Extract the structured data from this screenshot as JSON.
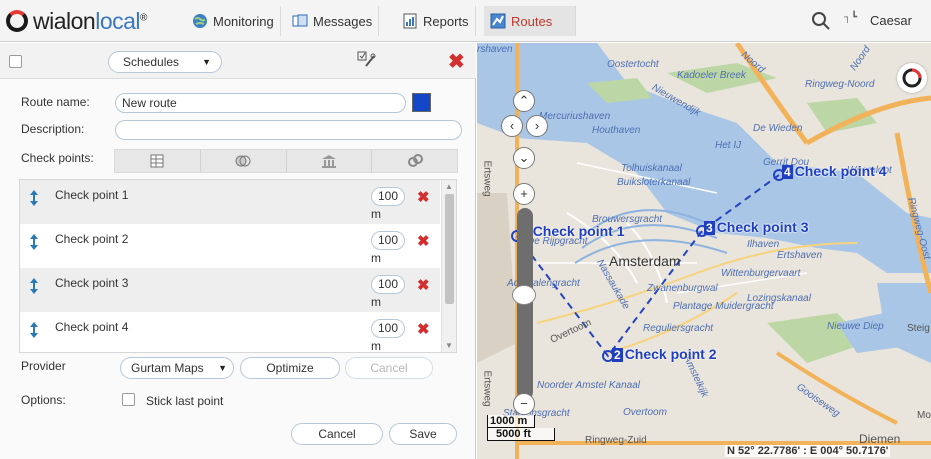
{
  "app": {
    "logo_text": "wialon",
    "logo_text_accent": "local",
    "logo_sup": "®"
  },
  "nav": {
    "tabs": [
      {
        "label": "Monitoring",
        "icon": "globe-icon"
      },
      {
        "label": "Messages",
        "icon": "messages-icon"
      },
      {
        "label": "Reports",
        "icon": "reports-icon"
      },
      {
        "label": "Routes",
        "icon": "routes-icon",
        "active": true
      }
    ],
    "search_icon": "search-icon",
    "small_icon": "window-icon",
    "user": "Caesar"
  },
  "panel": {
    "header": {
      "select_value": "Schedules",
      "tools_icon": "edit-tools-icon",
      "close_icon": "close-icon"
    },
    "route_name_label": "Route name:",
    "route_name_value": "New route",
    "route_color": "#1446c8",
    "description_label": "Description:",
    "description_value": "",
    "checkpoints_label": "Check points:",
    "toolbar_icons": [
      "table-icon",
      "geozones-icon",
      "buildings-icon",
      "address-icon"
    ],
    "checkpoints": [
      {
        "name": "Check point 1",
        "radius": "100",
        "unit": "m"
      },
      {
        "name": "Check point 2",
        "radius": "100",
        "unit": "m"
      },
      {
        "name": "Check point 3",
        "radius": "100",
        "unit": "m"
      },
      {
        "name": "Check point 4",
        "radius": "100",
        "unit": "m"
      }
    ],
    "provider_label": "Provider",
    "provider_value": "Gurtam Maps",
    "optimize_label": "Optimize",
    "cancel_provider_label": "Cancel",
    "options_label": "Options:",
    "stick_last_label": "Stick last point",
    "cancel_label": "Cancel",
    "save_label": "Save"
  },
  "map": {
    "labels": [
      "rshaven",
      "Oostertocht",
      "Kadoeler Breek",
      "Noord",
      "Ringweg-Noord",
      "Noord",
      "Mercuriushaven",
      "Nieuwendijk",
      "Houthaven",
      "De Wieden",
      "Het IJ",
      "Tolhuiskanaal",
      "Buiksloterkanaal",
      "Gerrit Dou",
      "Weersloot",
      "Brouwersgracht",
      "De Rijpgracht",
      "Ilhaven",
      "Ertshaven",
      "Amsterdam",
      "Admiralengracht",
      "Nassaukade",
      "Wittenburgervaart",
      "Zwanenburgwal",
      "Lozingskanaal",
      "Plantage Muidergracht",
      "Overtoom",
      "Reguliersgracht",
      "Nieuwe Diep",
      "Steig",
      "Noorder Amstel Kanaal",
      "Amstelkijk",
      "Stadionsgracht",
      "Overtoom",
      "Ringweg-Zuid",
      "Diemen",
      "Mo",
      "Gooiseweg",
      "Ringweg-Oost",
      "Ertsweg",
      "Ertsweg"
    ],
    "checkpoint_labels": [
      {
        "num": "1",
        "text": "Check point 1"
      },
      {
        "num": "2",
        "text": "Check point 2"
      },
      {
        "num": "3",
        "text": "Check point 3"
      },
      {
        "num": "4",
        "text": "Check point 4"
      }
    ],
    "scale_metric": "1000 m",
    "scale_imperial": "5000 ft",
    "coords": "N 52° 22.7786' : E 004° 50.7176'",
    "route_color": "#2343c2"
  }
}
